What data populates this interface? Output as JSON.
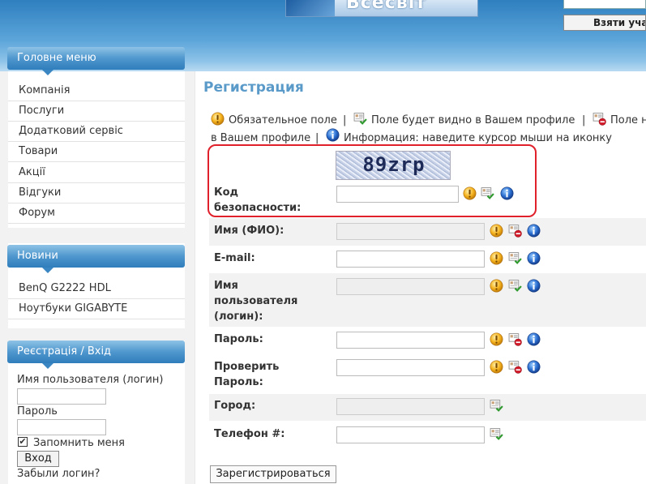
{
  "header": {
    "logo_text": "Всесвіт",
    "login_button": "Взяти уча"
  },
  "sidebar": {
    "main_menu": {
      "title": "Головне меню",
      "items": [
        "Компанія",
        "Послуги",
        "Додатковий сервіс",
        "Товари",
        "Акції",
        "Відгуки",
        "Форум"
      ]
    },
    "news": {
      "title": "Новини",
      "items": [
        "BenQ G2222 HDL",
        "Ноутбуки GIGABYTE"
      ]
    },
    "login": {
      "title": "Реєстрація / Вхід",
      "username_label": "Имя пользователя (логин)",
      "password_label": "Пароль",
      "remember_label": "Запомнить меня",
      "remember_checked": "✔",
      "login_button": "Вход",
      "forgot_link": "Забыли логин?"
    }
  },
  "main": {
    "title": "Регистрация",
    "legend": {
      "line1_a": "Обязательное поле",
      "sep": "|",
      "line1_b": "Поле будет видно в Вашем профиле",
      "line1_c": "Поле н",
      "line2_a": "в Вашем профиле",
      "line2_b": "Информация: наведите курсор мыши на иконку"
    },
    "captcha": {
      "code": "89zrp",
      "label_line1": "Код",
      "label_line2": "безопасности:"
    },
    "fields": {
      "name": "Имя (ФИО):",
      "email": "E-mail:",
      "username_l1": "Имя",
      "username_l2": "пользователя",
      "username_l3": "(логин):",
      "password": "Пароль:",
      "password2_l1": "Проверить",
      "password2_l2": "Пароль:",
      "city": "Город:",
      "phone": "Телефон #:"
    },
    "submit_button": "Зарегистрироваться"
  },
  "colors": {
    "accent": "#5a9ac9",
    "menu_title_bg": "#4f97ce",
    "captcha_frame": "#e0202a",
    "required_icon": "#f2a51a",
    "info_icon": "#2b6fd1",
    "hidden_icon": "#d21b2a"
  }
}
